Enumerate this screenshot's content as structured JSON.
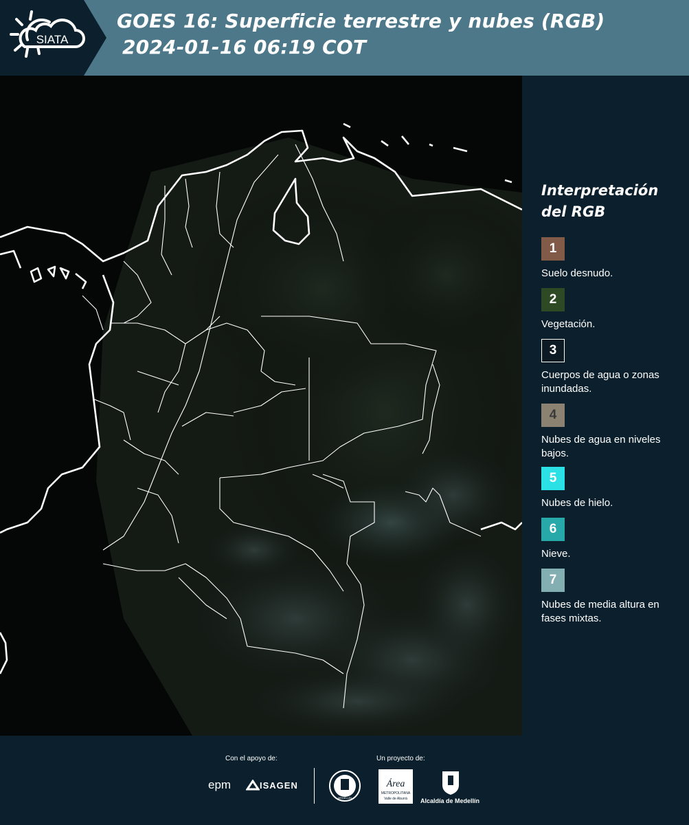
{
  "header": {
    "logo_text": "SIATA",
    "title_line1": "GOES 16: Superficie terrestre y nubes (RGB)",
    "title_line2": "2024-01-16 06:19 COT"
  },
  "legend": {
    "title_line1": "Interpretación",
    "title_line2": "del RGB",
    "items": [
      {
        "number": "1",
        "label": "Suelo desnudo.",
        "color": "#825b48"
      },
      {
        "number": "2",
        "label": "Vegetación.",
        "color": "#2e4a25"
      },
      {
        "number": "3",
        "label": "Cuerpos de agua o zonas inundadas.",
        "color": "#0c1a23"
      },
      {
        "number": "4",
        "label": "Nubes de agua en niveles bajos.",
        "color": "#8c8272"
      },
      {
        "number": "5",
        "label": "Nubes de hielo.",
        "color": "#2ce1e6"
      },
      {
        "number": "6",
        "label": "Nieve.",
        "color": "#27a8a9"
      },
      {
        "number": "7",
        "label": "Nubes de media altura en fases mixtas.",
        "color": "#83aeb2"
      }
    ]
  },
  "footer": {
    "support_label": "Con el apoyo de:",
    "project_label": "Un proyecto de:",
    "sponsors": [
      "epm",
      "ISAGEN"
    ],
    "area_logo_text": "Área",
    "area_sub1": "METROPOLITANA",
    "area_sub2": "Valle de Aburrá",
    "alcaldia": "Alcaldía de Medellín",
    "seal_text": "MEDELLÍN"
  }
}
